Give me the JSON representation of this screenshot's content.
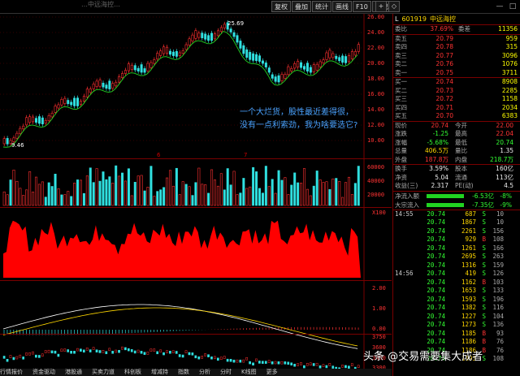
{
  "toolbar": {
    "ghost_title": "…中远海控…",
    "buttons": [
      "复权",
      "叠加",
      "统计",
      "画线",
      "F10",
      "标记"
    ],
    "tools": [
      "+",
      "◇"
    ],
    "window": [
      "—",
      "□"
    ]
  },
  "main_chart": {
    "y_labels": [
      "26.00",
      "24.00",
      "22.00",
      "20.00",
      "18.00",
      "16.00",
      "14.00",
      "12.00",
      "10.00"
    ],
    "high_label": "25.69",
    "low_label": "9.46",
    "comment_line1": "一个大烂货，股性最近差得很，",
    "comment_line2": "没有一点利索劲，我为啥要选它?",
    "x_ticks": [
      "6",
      "7"
    ]
  },
  "volume_panel": {
    "y_labels": [
      "60000",
      "40000",
      "20000"
    ]
  },
  "panel3": {
    "y_labels": [
      "X100"
    ]
  },
  "macd_panel": {
    "y_labels": [
      "2.00",
      "1.00",
      "0.00"
    ]
  },
  "index_panel": {
    "y_labels": [
      "3750",
      "3600",
      "3450",
      "3300"
    ],
    "x_ticks": [
      "5",
      "6",
      "7",
      "8"
    ]
  },
  "bottom_tabs": [
    "行情报价",
    "资金驱动",
    "港股通",
    "买卖力道",
    "科创板",
    "增减持",
    "指数",
    "分析",
    "分时",
    "K线图",
    "更多"
  ],
  "stock": {
    "code": "601919",
    "name": "中远海控",
    "flag": "L"
  },
  "weibi": {
    "label": "委比",
    "value": "37.69%",
    "label2": "委差",
    "value2": "11356"
  },
  "asks": [
    {
      "label": "卖五",
      "price": "20.79",
      "vol": "959"
    },
    {
      "label": "卖四",
      "price": "20.78",
      "vol": "315"
    },
    {
      "label": "卖三",
      "price": "20.77",
      "vol": "3096"
    },
    {
      "label": "卖二",
      "price": "20.76",
      "vol": "1076"
    },
    {
      "label": "卖一",
      "price": "20.75",
      "vol": "3711"
    }
  ],
  "bids": [
    {
      "label": "买一",
      "price": "20.74",
      "vol": "8908"
    },
    {
      "label": "买二",
      "price": "20.73",
      "vol": "2285"
    },
    {
      "label": "买三",
      "price": "20.72",
      "vol": "1158"
    },
    {
      "label": "买四",
      "price": "20.71",
      "vol": "2034"
    },
    {
      "label": "买五",
      "price": "20.70",
      "vol": "6383"
    }
  ],
  "stats": [
    {
      "l1": "现价",
      "v1": "20.74",
      "l2": "今开",
      "v2": "22.00",
      "c1": "red",
      "c2": "red"
    },
    {
      "l1": "涨跌",
      "v1": "-1.25",
      "l2": "最高",
      "v2": "22.04",
      "c1": "green",
      "c2": "red"
    },
    {
      "l1": "涨幅",
      "v1": "-5.68%",
      "l2": "最低",
      "v2": "20.74",
      "c1": "green",
      "c2": "green"
    },
    {
      "l1": "总量",
      "v1": "406.5万",
      "l2": "量比",
      "v2": "1.35",
      "c1": "yellow",
      "c2": "white"
    },
    {
      "l1": "外盘",
      "v1": "187.8万",
      "l2": "内盘",
      "v2": "218.7万",
      "c1": "red",
      "c2": "green"
    }
  ],
  "stats2": [
    {
      "l1": "换手",
      "v1": "3.59%",
      "l2": "股本",
      "v2": "160亿"
    },
    {
      "l1": "净资",
      "v1": "5.04",
      "l2": "流通",
      "v2": "113亿"
    },
    {
      "l1": "收益(三)",
      "v1": "2.317",
      "l2": "PE(动)",
      "v2": "4.5"
    }
  ],
  "flows": [
    {
      "label": "净流入额",
      "value": "-6.53亿",
      "pct": "-8%"
    },
    {
      "label": "大宗流入",
      "value": "-7.35亿",
      "pct": "-9%"
    }
  ],
  "ticks_header": "14:55",
  "ticks_header2": "14:56",
  "ticks": [
    {
      "t": "14:55",
      "p": "20.74",
      "q": "687",
      "s": "S",
      "n": "10"
    },
    {
      "t": "",
      "p": "20.74",
      "q": "1867",
      "s": "S",
      "n": "10"
    },
    {
      "t": "",
      "p": "20.74",
      "q": "2261",
      "s": "S",
      "n": "156"
    },
    {
      "t": "",
      "p": "20.74",
      "q": "929",
      "s": "B",
      "n": "108"
    },
    {
      "t": "",
      "p": "20.74",
      "q": "1261",
      "s": "S",
      "n": "166"
    },
    {
      "t": "",
      "p": "20.74",
      "q": "2695",
      "s": "S",
      "n": "263"
    },
    {
      "t": "",
      "p": "20.74",
      "q": "1316",
      "s": "S",
      "n": "159"
    },
    {
      "t": "14:56",
      "p": "20.74",
      "q": "419",
      "s": "S",
      "n": "126"
    },
    {
      "t": "",
      "p": "20.74",
      "q": "1162",
      "s": "B",
      "n": "103"
    },
    {
      "t": "",
      "p": "20.74",
      "q": "1653",
      "s": "S",
      "n": "133"
    },
    {
      "t": "",
      "p": "20.74",
      "q": "1593",
      "s": "S",
      "n": "196"
    },
    {
      "t": "",
      "p": "20.74",
      "q": "1382",
      "s": "S",
      "n": "116"
    },
    {
      "t": "",
      "p": "20.74",
      "q": "1227",
      "s": "S",
      "n": "104"
    },
    {
      "t": "",
      "p": "20.74",
      "q": "1273",
      "s": "S",
      "n": "136"
    },
    {
      "t": "",
      "p": "20.74",
      "q": "1185",
      "s": "B",
      "n": "93"
    },
    {
      "t": "",
      "p": "20.74",
      "q": "1186",
      "s": "B",
      "n": "76"
    },
    {
      "t": "",
      "p": "20.74",
      "q": "1186",
      "s": "B",
      "n": "76"
    },
    {
      "t": "",
      "p": "20.74",
      "q": "1193",
      "s": "S",
      "n": "108"
    }
  ],
  "watermark": "头条 @交易需要集大成者"
}
